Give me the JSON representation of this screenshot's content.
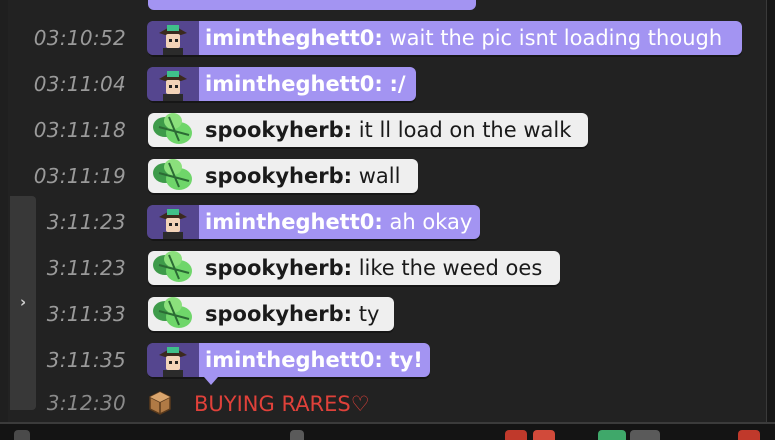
{
  "chat": {
    "messages": [
      {
        "time": "03:10:52",
        "user": "imintheghett0:",
        "text": "wait the pic isnt loading though",
        "style": "purple",
        "avatar": "ghetto-avatar-icon"
      },
      {
        "time": "03:11:04",
        "user": "imintheghett0:",
        "text": ":/",
        "style": "purple",
        "avatar": "ghetto-avatar-icon"
      },
      {
        "time": "03:11:18",
        "user": "spookyherb:",
        "text": "it ll load on the walk",
        "style": "white",
        "avatar": "herb-avatar-icon"
      },
      {
        "time": "03:11:19",
        "user": "spookyherb:",
        "text": "wall",
        "style": "white",
        "avatar": "herb-avatar-icon"
      },
      {
        "time": "3:11:23",
        "user": "imintheghett0:",
        "text": "ah okay",
        "style": "purple",
        "avatar": "ghetto-avatar-icon"
      },
      {
        "time": "3:11:23",
        "user": "spookyherb:",
        "text": "like the weed oes",
        "style": "white",
        "avatar": "herb-avatar-icon"
      },
      {
        "time": "3:11:33",
        "user": "spookyherb:",
        "text": "ty",
        "style": "white",
        "avatar": "herb-avatar-icon"
      },
      {
        "time": "3:11:35",
        "user": "imintheghett0:",
        "text": "ty!",
        "style": "purple",
        "avatar": "ghetto-avatar-icon"
      }
    ],
    "system": {
      "time": "3:12:30",
      "text": "BUYING RARES♡",
      "color": "#e0413a",
      "icon": "shop-box-icon"
    },
    "collapse_icon": "chevron-right-icon"
  },
  "colors": {
    "purple_bubble": "#a394f2",
    "white_bubble": "#efefef",
    "background": "#222222",
    "timestamp": "#9a9a9a"
  }
}
